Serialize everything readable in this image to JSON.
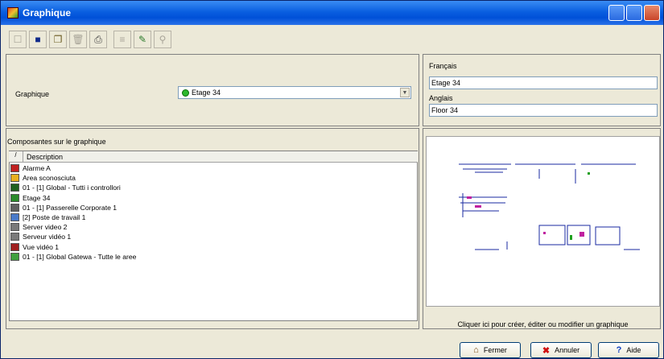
{
  "window": {
    "title": "Graphique"
  },
  "toolbar": {
    "items": [
      {
        "icon": "new-icon",
        "enabled": false
      },
      {
        "icon": "save-icon",
        "enabled": true
      },
      {
        "icon": "copy-icon",
        "enabled": true
      },
      {
        "icon": "delete-icon",
        "enabled": false
      },
      {
        "icon": "print-icon",
        "enabled": true
      },
      {
        "icon": "list-icon",
        "enabled": false
      },
      {
        "icon": "tool-icon",
        "enabled": true
      },
      {
        "icon": "binoculars-icon",
        "enabled": false
      }
    ]
  },
  "form": {
    "graphique_label": "Graphique",
    "graphique_value": "Etage 34",
    "francais_label": "Français",
    "francais_value": "Etage 34",
    "anglais_label": "Anglais",
    "anglais_value": "Floor 34"
  },
  "components": {
    "section_label": "Composantes sur le graphique",
    "column_header": "Description",
    "rows": [
      {
        "label": "Alarme A",
        "icon_color": "#c02020"
      },
      {
        "label": "Area sconosciuta",
        "icon_color": "#e8b020"
      },
      {
        "label": "01 - [1]  Global - Tutti i controllori",
        "icon_color": "#206020"
      },
      {
        "label": "Etage 34",
        "icon_color": "#2a8a2a"
      },
      {
        "label": "01 - [1]  Passerelle Corporate 1",
        "icon_color": "#606060"
      },
      {
        "label": "[2]  Poste de travail 1",
        "icon_color": "#4a7ac8"
      },
      {
        "label": "Server video 2",
        "icon_color": "#7a7a7a"
      },
      {
        "label": "Serveur vidéo 1",
        "icon_color": "#7a7a7a"
      },
      {
        "label": "Vue vidéo 1",
        "icon_color": "#a02020"
      },
      {
        "label": "01 - [1]  Global Gatewa - Tutte le aree",
        "icon_color": "#40a040"
      }
    ]
  },
  "preview": {
    "caption": "Cliquer ici pour créer, éditer ou modifier un graphique"
  },
  "buttons": {
    "fermer": "Fermer",
    "annuler": "Annuler",
    "aide": "Aide"
  }
}
